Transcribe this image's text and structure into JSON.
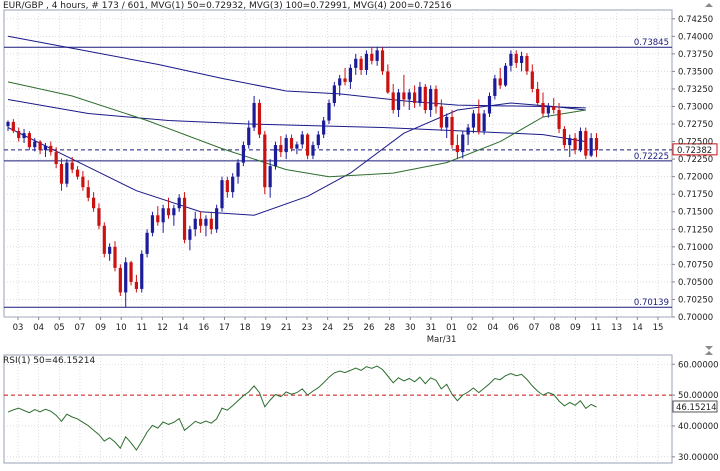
{
  "header": {
    "text": "EUR/GBP , 4 hours, # 173 / 601, MVG(1) 50=0.72932, MVG(3) 100=0.72991, MVG(4) 200=0.72516"
  },
  "rsi_header": {
    "text": "RSI(1) 50=46.15214"
  },
  "colors": {
    "bull": "#1c1c9a",
    "bear": "#cc1111",
    "ma_navy": "#1a1a8a",
    "ma_green": "#2e6e2e",
    "rsi": "#2e6e2e",
    "grid": "#c7c7d6",
    "level": "#1a1a7a",
    "current": "#cc1111"
  },
  "chart_data": [
    {
      "type": "candlestick",
      "ylim": [
        0.7,
        0.74375
      ],
      "y_ticks": [
        "0.74250",
        "0.74000",
        "0.73750",
        "0.73500",
        "0.73250",
        "0.73000",
        "0.72750",
        "0.72500",
        "0.72250",
        "0.72000",
        "0.71750",
        "0.71500",
        "0.71250",
        "0.71000",
        "0.70750",
        "0.70500",
        "0.70250",
        "0.70000"
      ],
      "x_labels": [
        "03",
        "04",
        "05",
        "07",
        "09",
        "10",
        "11",
        "12",
        "14",
        "16",
        "17",
        "18",
        "19",
        "21",
        "23",
        "24",
        "25",
        "26",
        "28",
        "30",
        "31",
        "01",
        "02",
        "04",
        "06",
        "07",
        "08",
        "09",
        "11",
        "13",
        "14",
        "15"
      ],
      "x_sublabel": "Mar/31",
      "levels": [
        {
          "label": "0.73845",
          "value": 0.73845
        },
        {
          "label": "0.72225",
          "value": 0.72225
        },
        {
          "label": "0.70139",
          "value": 0.70139
        }
      ],
      "current_price": {
        "label": "0.72382",
        "value": 0.72382
      },
      "candles": [
        [
          0.7272,
          0.728,
          0.7265,
          0.7278
        ],
        [
          0.7278,
          0.7282,
          0.7262,
          0.7265
        ],
        [
          0.7265,
          0.727,
          0.725,
          0.7255
        ],
        [
          0.7255,
          0.7268,
          0.7248,
          0.7262
        ],
        [
          0.7262,
          0.7265,
          0.7238,
          0.7242
        ],
        [
          0.7242,
          0.7255,
          0.7236,
          0.725
        ],
        [
          0.725,
          0.7252,
          0.7232,
          0.7238
        ],
        [
          0.7238,
          0.7248,
          0.7228,
          0.7244
        ],
        [
          0.7244,
          0.725,
          0.723,
          0.7235
        ],
        [
          0.7235,
          0.7242,
          0.7212,
          0.7218
        ],
        [
          0.7218,
          0.7226,
          0.718,
          0.719
        ],
        [
          0.719,
          0.7225,
          0.7185,
          0.722
        ],
        [
          0.722,
          0.7228,
          0.7205,
          0.721
        ],
        [
          0.721,
          0.7215,
          0.7196,
          0.72
        ],
        [
          0.72,
          0.7208,
          0.718,
          0.7185
        ],
        [
          0.7185,
          0.7195,
          0.7165,
          0.717
        ],
        [
          0.717,
          0.7178,
          0.715,
          0.7155
        ],
        [
          0.7155,
          0.7162,
          0.7125,
          0.713
        ],
        [
          0.713,
          0.7135,
          0.7085,
          0.709
        ],
        [
          0.709,
          0.7105,
          0.708,
          0.71
        ],
        [
          0.71,
          0.7108,
          0.7065,
          0.707
        ],
        [
          0.707,
          0.7075,
          0.703,
          0.7035
        ],
        [
          0.7035,
          0.7085,
          0.7014,
          0.7078
        ],
        [
          0.7078,
          0.708,
          0.7045,
          0.705
        ],
        [
          0.705,
          0.706,
          0.7035,
          0.704
        ],
        [
          0.704,
          0.7095,
          0.7035,
          0.709
        ],
        [
          0.709,
          0.7125,
          0.7085,
          0.712
        ],
        [
          0.712,
          0.715,
          0.7115,
          0.7145
        ],
        [
          0.7145,
          0.7158,
          0.713,
          0.7135
        ],
        [
          0.7135,
          0.716,
          0.712,
          0.7155
        ],
        [
          0.7155,
          0.717,
          0.714,
          0.7145
        ],
        [
          0.7145,
          0.716,
          0.713,
          0.7155
        ],
        [
          0.7155,
          0.7175,
          0.715,
          0.717
        ],
        [
          0.717,
          0.7178,
          0.7105,
          0.711
        ],
        [
          0.711,
          0.713,
          0.7095,
          0.7125
        ],
        [
          0.7125,
          0.715,
          0.7115,
          0.714
        ],
        [
          0.714,
          0.715,
          0.712,
          0.713
        ],
        [
          0.713,
          0.7145,
          0.7115,
          0.714
        ],
        [
          0.714,
          0.715,
          0.7118,
          0.7125
        ],
        [
          0.7125,
          0.716,
          0.712,
          0.7155
        ],
        [
          0.7155,
          0.72,
          0.715,
          0.7195
        ],
        [
          0.7195,
          0.72,
          0.717,
          0.7178
        ],
        [
          0.7178,
          0.7205,
          0.717,
          0.72
        ],
        [
          0.72,
          0.7225,
          0.719,
          0.722
        ],
        [
          0.722,
          0.725,
          0.7215,
          0.7245
        ],
        [
          0.7245,
          0.728,
          0.724,
          0.727
        ],
        [
          0.727,
          0.7315,
          0.7265,
          0.7305
        ],
        [
          0.7305,
          0.731,
          0.7255,
          0.726
        ],
        [
          0.726,
          0.7265,
          0.7175,
          0.7185
        ],
        [
          0.7185,
          0.7225,
          0.717,
          0.7215
        ],
        [
          0.7215,
          0.725,
          0.721,
          0.7245
        ],
        [
          0.7245,
          0.7258,
          0.7228,
          0.7235
        ],
        [
          0.7235,
          0.726,
          0.7225,
          0.7255
        ],
        [
          0.7255,
          0.726,
          0.7236,
          0.724
        ],
        [
          0.724,
          0.725,
          0.7232,
          0.7246
        ],
        [
          0.7246,
          0.7265,
          0.724,
          0.726
        ],
        [
          0.726,
          0.7262,
          0.7225,
          0.723
        ],
        [
          0.723,
          0.725,
          0.7225,
          0.7245
        ],
        [
          0.7245,
          0.7265,
          0.724,
          0.726
        ],
        [
          0.726,
          0.7285,
          0.7255,
          0.728
        ],
        [
          0.728,
          0.731,
          0.7275,
          0.7305
        ],
        [
          0.7305,
          0.7335,
          0.73,
          0.733
        ],
        [
          0.733,
          0.7345,
          0.7315,
          0.734
        ],
        [
          0.734,
          0.7355,
          0.733,
          0.7335
        ],
        [
          0.7335,
          0.736,
          0.7325,
          0.7355
        ],
        [
          0.7355,
          0.7375,
          0.7345,
          0.7368
        ],
        [
          0.7368,
          0.7372,
          0.7345,
          0.7352
        ],
        [
          0.7352,
          0.738,
          0.7345,
          0.7375
        ],
        [
          0.7375,
          0.7385,
          0.736,
          0.7365
        ],
        [
          0.7365,
          0.7385,
          0.7358,
          0.738
        ],
        [
          0.738,
          0.7384,
          0.7345,
          0.735
        ],
        [
          0.735,
          0.736,
          0.7318,
          0.732
        ],
        [
          0.732,
          0.7332,
          0.729,
          0.7295
        ],
        [
          0.7295,
          0.7325,
          0.7285,
          0.732
        ],
        [
          0.732,
          0.7345,
          0.73,
          0.731
        ],
        [
          0.731,
          0.7325,
          0.7295,
          0.732
        ],
        [
          0.732,
          0.733,
          0.7298,
          0.7305
        ],
        [
          0.7305,
          0.7335,
          0.73,
          0.7328
        ],
        [
          0.7328,
          0.7332,
          0.729,
          0.7295
        ],
        [
          0.7295,
          0.733,
          0.7285,
          0.7325
        ],
        [
          0.7325,
          0.733,
          0.729,
          0.73
        ],
        [
          0.73,
          0.731,
          0.7265,
          0.727
        ],
        [
          0.727,
          0.729,
          0.7255,
          0.7285
        ],
        [
          0.7285,
          0.7295,
          0.724,
          0.7245
        ],
        [
          0.7245,
          0.726,
          0.7225,
          0.7235
        ],
        [
          0.7235,
          0.7265,
          0.7226,
          0.726
        ],
        [
          0.726,
          0.7275,
          0.7245,
          0.727
        ],
        [
          0.727,
          0.7295,
          0.7262,
          0.729
        ],
        [
          0.729,
          0.731,
          0.726,
          0.7265
        ],
        [
          0.7265,
          0.7295,
          0.726,
          0.729
        ],
        [
          0.729,
          0.732,
          0.7285,
          0.7315
        ],
        [
          0.7315,
          0.7345,
          0.731,
          0.734
        ],
        [
          0.734,
          0.7355,
          0.7325,
          0.733
        ],
        [
          0.733,
          0.7362,
          0.7328,
          0.7358
        ],
        [
          0.7358,
          0.738,
          0.735,
          0.7375
        ],
        [
          0.7375,
          0.738,
          0.7355,
          0.7362
        ],
        [
          0.7362,
          0.7378,
          0.735,
          0.7372
        ],
        [
          0.7372,
          0.7376,
          0.7345,
          0.735
        ],
        [
          0.735,
          0.736,
          0.732,
          0.7325
        ],
        [
          0.7325,
          0.7335,
          0.73,
          0.7305
        ],
        [
          0.7305,
          0.732,
          0.7285,
          0.729
        ],
        [
          0.729,
          0.7305,
          0.7284,
          0.73
        ],
        [
          0.73,
          0.7312,
          0.729,
          0.7295
        ],
        [
          0.7295,
          0.7305,
          0.7262,
          0.7268
        ],
        [
          0.7268,
          0.7272,
          0.724,
          0.7245
        ],
        [
          0.7245,
          0.726,
          0.7228,
          0.7255
        ],
        [
          0.7255,
          0.7262,
          0.7232,
          0.7238
        ],
        [
          0.7238,
          0.727,
          0.7235,
          0.7265
        ],
        [
          0.7265,
          0.727,
          0.7225,
          0.723
        ],
        [
          0.723,
          0.7262,
          0.7228,
          0.7255
        ],
        [
          0.7255,
          0.7262,
          0.7228,
          0.7238
        ]
      ],
      "ma_series": [
        {
          "id": "MVG(1)",
          "color": "#1a1a8a",
          "points": [
            [
              0,
              0.727
            ],
            [
              12,
              0.7225
            ],
            [
              24,
              0.718
            ],
            [
              36,
              0.715
            ],
            [
              46,
              0.7145
            ],
            [
              56,
              0.7172
            ],
            [
              64,
              0.7205
            ],
            [
              74,
              0.7262
            ],
            [
              84,
              0.7295
            ],
            [
              94,
              0.7305
            ],
            [
              102,
              0.73
            ],
            [
              108,
              0.7295
            ]
          ]
        },
        {
          "id": "MVG(3)",
          "color": "#1a1a8a",
          "points": [
            [
              0,
              0.731
            ],
            [
              15,
              0.729
            ],
            [
              30,
              0.728
            ],
            [
              45,
              0.7275
            ],
            [
              60,
              0.7272
            ],
            [
              70,
              0.727
            ],
            [
              85,
              0.7265
            ],
            [
              100,
              0.726
            ],
            [
              108,
              0.725
            ]
          ]
        },
        {
          "id": "MVG(4)",
          "color": "#2e6e2e",
          "points": [
            [
              0,
              0.7335
            ],
            [
              12,
              0.7315
            ],
            [
              26,
              0.728
            ],
            [
              40,
              0.724
            ],
            [
              52,
              0.721
            ],
            [
              60,
              0.72
            ],
            [
              72,
              0.7205
            ],
            [
              82,
              0.722
            ],
            [
              92,
              0.725
            ],
            [
              100,
              0.7285
            ],
            [
              108,
              0.7295
            ]
          ]
        },
        {
          "id": "MVG-long",
          "color": "#1a1a8a",
          "points": [
            [
              0,
              0.74
            ],
            [
              14,
              0.738
            ],
            [
              28,
              0.736
            ],
            [
              40,
              0.734
            ],
            [
              52,
              0.7322
            ],
            [
              62,
              0.7318
            ],
            [
              74,
              0.7308
            ],
            [
              84,
              0.7302
            ],
            [
              100,
              0.73
            ],
            [
              108,
              0.7298
            ]
          ]
        }
      ]
    },
    {
      "type": "line",
      "name": "RSI(1) 50",
      "ylim": [
        28,
        63
      ],
      "y_ticks": [
        "60.00000",
        "50.00000",
        "40.00000",
        "30.00000"
      ],
      "reference_level": 50,
      "current": {
        "label": "46.15214",
        "value": 46.15214
      },
      "values": [
        44.5,
        45.2,
        45.8,
        45.0,
        44.3,
        45.3,
        44.6,
        45.4,
        44.8,
        43.5,
        41.5,
        43.8,
        42.9,
        42.3,
        41.2,
        40.1,
        38.6,
        37.2,
        35.1,
        36.2,
        34.8,
        32.8,
        36.5,
        34.5,
        32.2,
        35.0,
        38.0,
        40.2,
        39.3,
        41.3,
        40.5,
        41.2,
        42.4,
        38.6,
        40.0,
        41.5,
        40.8,
        41.6,
        40.9,
        42.3,
        45.8,
        45.1,
        46.6,
        48.2,
        49.8,
        51.0,
        53.0,
        50.8,
        46.2,
        48.4,
        50.2,
        49.5,
        51.0,
        50.3,
        50.8,
        52.0,
        50.0,
        51.3,
        52.4,
        54.0,
        55.8,
        57.2,
        57.8,
        57.3,
        58.0,
        58.8,
        58.0,
        59.2,
        58.7,
        59.4,
        58.3,
        56.2,
        54.0,
        55.6,
        54.6,
        55.4,
        54.3,
        55.8,
        53.7,
        55.6,
        54.8,
        52.0,
        53.5,
        50.3,
        48.2,
        50.0,
        51.0,
        52.3,
        50.8,
        52.2,
        53.7,
        55.4,
        55.0,
        56.3,
        57.0,
        56.3,
        56.7,
        55.1,
        53.0,
        51.3,
        50.0,
        50.8,
        50.2,
        48.1,
        46.5,
        47.6,
        46.7,
        48.2,
        45.7,
        47.0,
        46.15
      ]
    }
  ]
}
